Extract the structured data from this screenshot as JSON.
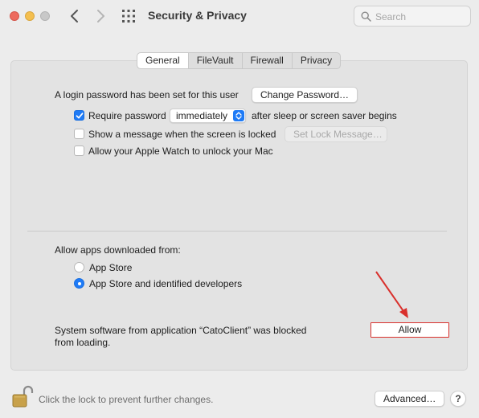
{
  "window": {
    "title": "Security & Privacy",
    "search_placeholder": "Search"
  },
  "tabs": [
    {
      "label": "General",
      "active": true
    },
    {
      "label": "FileVault",
      "active": false
    },
    {
      "label": "Firewall",
      "active": false
    },
    {
      "label": "Privacy",
      "active": false
    }
  ],
  "general": {
    "login_password_text": "A login password has been set for this user",
    "change_password_button": "Change Password…",
    "require_password": {
      "label": "Require password",
      "checked": true,
      "selected_option": "immediately",
      "suffix": "after sleep or screen saver begins"
    },
    "show_message": {
      "label": "Show a message when the screen is locked",
      "checked": false,
      "button": "Set Lock Message…"
    },
    "apple_watch": {
      "label": "Allow your Apple Watch to unlock your Mac",
      "checked": false
    }
  },
  "allow_apps": {
    "heading": "Allow apps downloaded from:",
    "options": [
      {
        "label": "App Store",
        "selected": false
      },
      {
        "label": "App Store and identified developers",
        "selected": true
      }
    ]
  },
  "blocked": {
    "line1": "System software from application “CatoClient” was blocked",
    "line2": "from loading.",
    "allow_button": "Allow"
  },
  "footer": {
    "lock_text": "Click the lock to prevent further changes.",
    "advanced_button": "Advanced…",
    "help_button": "?"
  },
  "colors": {
    "accent": "#1f7bf6",
    "annotation_red": "#d9302c"
  }
}
